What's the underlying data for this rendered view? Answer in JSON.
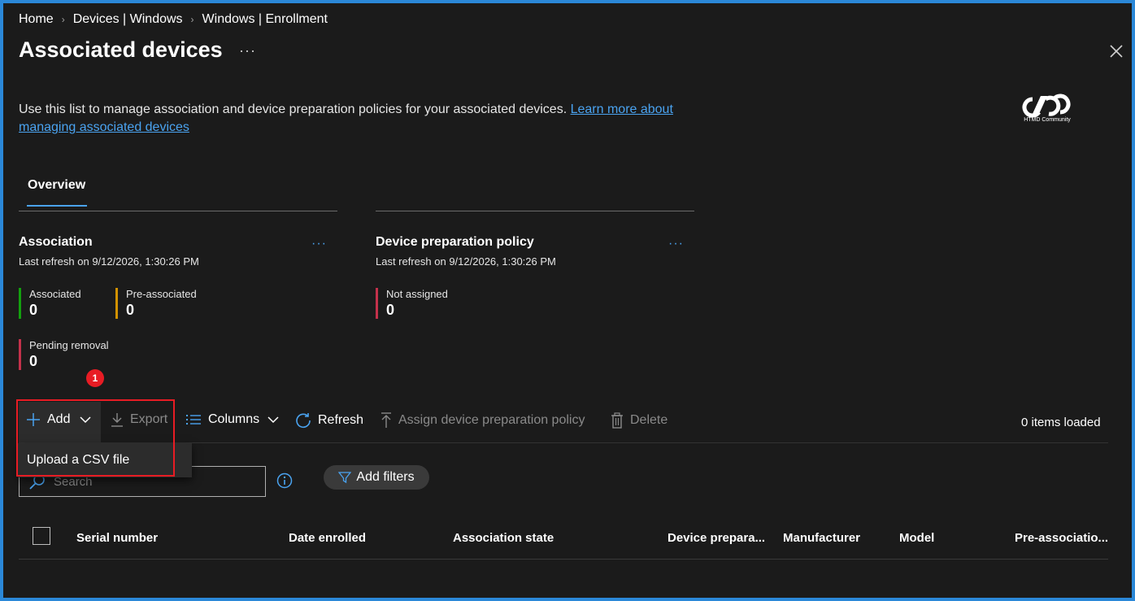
{
  "breadcrumb": [
    "Home",
    "Devices | Windows",
    "Windows | Enrollment"
  ],
  "page": {
    "title": "Associated devices",
    "more": "···",
    "description": "Use this list to manage association and device preparation policies for your associated devices.",
    "learn_more": "Learn more about managing associated devices"
  },
  "logo": {
    "text": "HTMD Community"
  },
  "tabs": [
    {
      "label": "Overview",
      "active": true
    }
  ],
  "association": {
    "title": "Association",
    "refresh": "Last refresh on 9/12/2026, 1:30:26 PM",
    "more": "···",
    "stats": [
      {
        "label": "Associated",
        "value": "0",
        "color": "#13a10e"
      },
      {
        "label": "Pre-associated",
        "value": "0",
        "color": "#d29200"
      },
      {
        "label": "Pending removal",
        "value": "0",
        "color": "#c4314b"
      }
    ]
  },
  "device_prep": {
    "title": "Device preparation policy",
    "refresh": "Last refresh on 9/12/2026, 1:30:26 PM",
    "more": "···",
    "stats": [
      {
        "label": "Not assigned",
        "value": "0",
        "color": "#c4314b"
      }
    ]
  },
  "annotation_badge": "1",
  "toolbar": {
    "add": "Add",
    "export": "Export",
    "columns": "Columns",
    "refresh": "Refresh",
    "assign": "Assign device preparation policy",
    "delete": "Delete",
    "items_loaded": "0 items loaded"
  },
  "add_menu": {
    "upload_csv": "Upload a CSV file"
  },
  "search": {
    "placeholder": "Search"
  },
  "filters": {
    "add_filters": "Add filters"
  },
  "table": {
    "columns": [
      "Serial number",
      "Date enrolled",
      "Association state",
      "Device prepara...",
      "Manufacturer",
      "Model",
      "Pre-associatio..."
    ]
  },
  "colors": {
    "accent": "#4aa3f0",
    "highlight": "#e81c24",
    "background": "#1b1b1b"
  }
}
